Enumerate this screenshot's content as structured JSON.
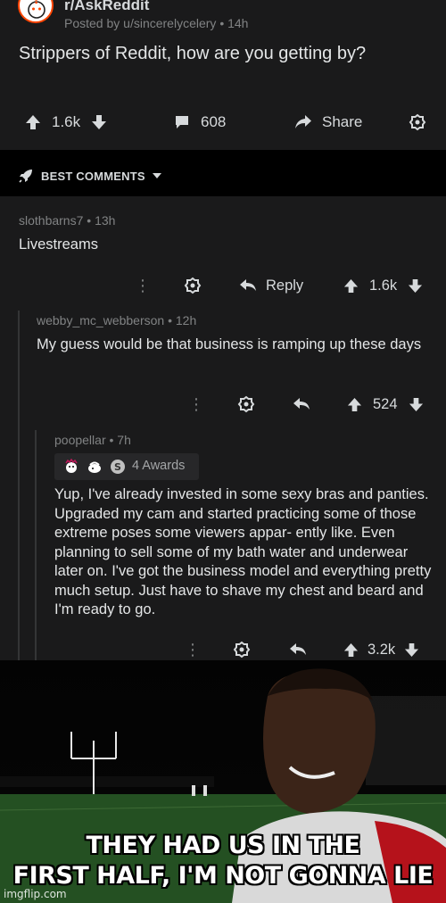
{
  "post": {
    "subreddit": "r/AskReddit",
    "posted_by": "Posted by u/sincerelycelery",
    "age": "14h",
    "title": "Strippers of Reddit, how are you getting by?",
    "upvotes": "1.6k",
    "comments": "608",
    "share_label": "Share"
  },
  "sort": {
    "label": "BEST COMMENTS"
  },
  "comments": [
    {
      "author": "slothbarns7",
      "age": "13h",
      "body": "Livestreams",
      "reply_label": "Reply",
      "score": "1.6k"
    },
    {
      "author": "webby_mc_webberson",
      "age": "12h",
      "body": "My guess would be that business is ramping up these days",
      "score": "524"
    },
    {
      "author": "poopellar",
      "age": "7h",
      "awards_label": "4 Awards",
      "body": "Yup, I've already invested in some sexy bras and panties. Upgraded my cam and started practicing some of those extreme poses some viewers appar- ently like. Even planning to sell some of my bath water and underwear later on. I've got the business model and everything pretty much setup. Just have to shave my chest and beard and I'm ready to go.",
      "score": "3.2k"
    }
  ],
  "meme": {
    "caption_line1": "THEY HAD US IN THE",
    "caption_line2": "FIRST HALF, I'M NOT GONNA LIE",
    "watermark": "imgflip.com"
  },
  "colors": {
    "background": "#1a1a1b",
    "text": "#d7dadc",
    "muted": "#818384"
  }
}
